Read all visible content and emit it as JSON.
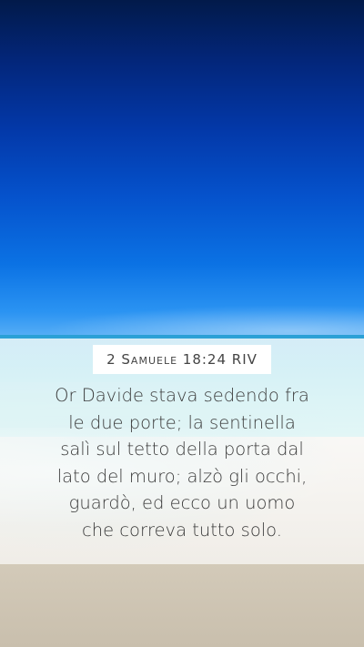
{
  "reference": "2 Samuele 18:24 RIV",
  "verse_lines": [
    "Or Davide stava sedendo fra",
    "le due porte; la sentinella",
    "salì sul tetto della porta dal",
    "lato del muro; alzò gli occhi,",
    "guardò, ed ecco un uomo",
    "che correva tutto solo."
  ],
  "colors": {
    "sky_top": "#021a4a",
    "sky_horizon": "#5ab0f6",
    "sea": "#3fbcd8",
    "sand": "#d3cab9",
    "text": "#3a3a3a"
  }
}
